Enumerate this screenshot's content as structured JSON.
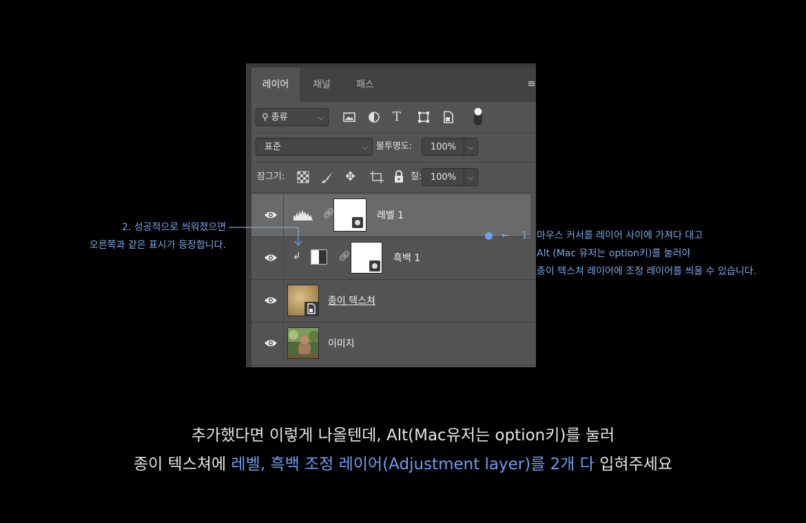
{
  "panel": {
    "tabs": [
      "레이어",
      "채널",
      "패스"
    ],
    "active_tab": "레이어",
    "menu_icon": "hamburger-icon",
    "filter": {
      "label": "종류",
      "icons": [
        "image-filter-icon",
        "adjustment-filter-icon",
        "type-filter-icon",
        "shape-filter-icon",
        "smartobject-filter-icon",
        "filter-toggle-icon"
      ]
    },
    "blend": {
      "mode": "표준",
      "opacity_label": "불투명도:",
      "opacity_value": "100%"
    },
    "lock": {
      "label": "잠그기:",
      "icons": [
        "lock-transparent-icon",
        "lock-paint-icon",
        "lock-move-icon",
        "lock-artboard-icon",
        "lock-all-icon"
      ],
      "fill_label": "칠:",
      "fill_value": "100%"
    },
    "layers": [
      {
        "name": "레벨 1",
        "type": "levels-adjustment",
        "selected": true
      },
      {
        "name": "흑백 1",
        "type": "black-white-adjustment",
        "clipped": true
      },
      {
        "name": "종이 텍스쳐",
        "type": "smart-object"
      },
      {
        "name": "이미지",
        "type": "image"
      }
    ]
  },
  "annotations": {
    "left": {
      "line1": "2. 성공적으로 씌워졌으면",
      "line2": "오른쪽과 같은 표시가 등장합니다."
    },
    "right": {
      "arrow": "←",
      "number": "1.",
      "line1": "마우스 커서를 레이어 사이에 가져다 대고",
      "line2": "Alt (Mac 유저는 option키)를 눌러야",
      "line3": "종이 텍스쳐 레이어에 조정 레이어를 씌울 수 있습니다."
    }
  },
  "caption": {
    "line1": "추가했다면 이렇게 나올텐데, Alt(Mac유저는 option키)를 눌러",
    "line2_pre": "종이 텍스쳐에 ",
    "line2_blue": "레벨, 흑백 조정 레이어(Adjustment layer)를 2개 다",
    "line2_post": " 입혀주세요"
  },
  "colors": {
    "accent_blue": "#6f9ef0",
    "panel_bg": "#535353",
    "selected_layer": "#6a6a6a"
  }
}
